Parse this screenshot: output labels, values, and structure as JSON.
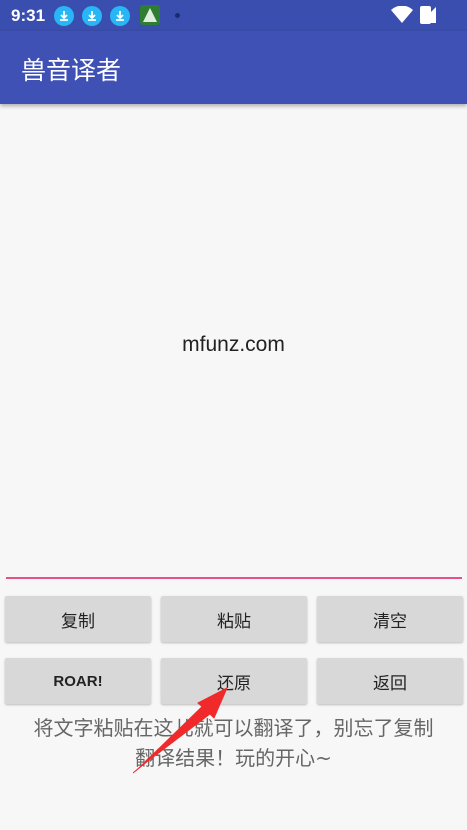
{
  "status_bar": {
    "time": "9:31",
    "icons": [
      "download-icon",
      "download-icon",
      "download-icon",
      "app-icon",
      "dot-icon",
      "wifi-icon",
      "signal-icon",
      "battery-icon"
    ]
  },
  "toolbar": {
    "title": "兽音译者"
  },
  "output": {
    "text": "mfunz.com"
  },
  "buttons": {
    "copy": "复制",
    "paste": "粘贴",
    "clear": "清空",
    "roar": "ROAR!",
    "restore": "还原",
    "back": "返回"
  },
  "hint": {
    "line1": "将文字粘贴在这儿就可以翻译了，别忘了复制",
    "line2": "翻译结果！玩的开心~"
  },
  "colors": {
    "status_bar": "#3a4eaf",
    "toolbar": "#3f51b5",
    "accent": "#e8508a",
    "annotation_arrow": "#f02a2a"
  }
}
